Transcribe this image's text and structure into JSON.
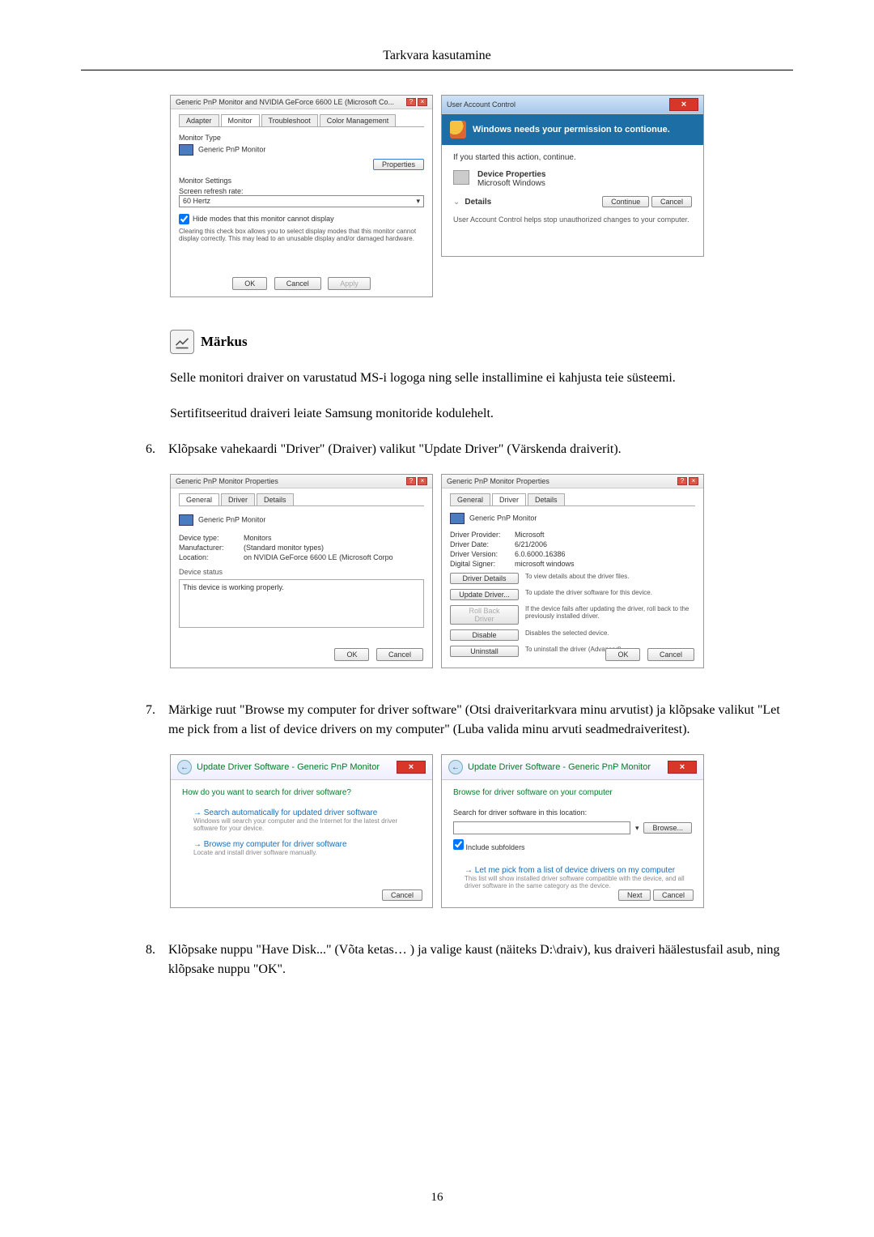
{
  "page_header": "Tarkvara kasutamine",
  "page_number": "16",
  "note": {
    "label": "Märkus"
  },
  "prose": {
    "p1": "Selle monitori draiver on varustatud MS-i logoga ning selle installimine ei kahjusta teie süsteemi.",
    "p2": "Sertifitseeritud draiveri leiate Samsung monitoride kodulehelt."
  },
  "steps": {
    "s6": {
      "num": "6.",
      "text": "Klõpsake vahekaardi \"Driver\" (Draiver) valikut \"Update Driver\" (Värskenda draiverit)."
    },
    "s7": {
      "num": "7.",
      "text": "Märkige ruut \"Browse my computer for driver software\" (Otsi draiveritarkvara minu arvutist) ja klõpsake valikut \"Let me pick from a list of device drivers on my computer\" (Luba valida minu arvuti seadmedraiveritest)."
    },
    "s8": {
      "num": "8.",
      "text": "Klõpsake nuppu \"Have Disk...\" (Võta ketas… ) ja valige kaust (näiteks D:\\draiv), kus draiveri häälestusfail asub, ning klõpsake nuppu \"OK\"."
    }
  },
  "monitorDlg": {
    "title": "Generic PnP Monitor and NVIDIA GeForce 6600 LE (Microsoft Co...",
    "tabs": {
      "adapter": "Adapter",
      "monitor": "Monitor",
      "troubleshoot": "Troubleshoot",
      "color": "Color Management"
    },
    "monitorTypeLabel": "Monitor Type",
    "monitorType": "Generic PnP Monitor",
    "propertiesBtn": "Properties",
    "settingsLabel": "Monitor Settings",
    "refreshLabel": "Screen refresh rate:",
    "refreshVal": "60 Hertz",
    "hideModes": "Hide modes that this monitor cannot display",
    "hideDesc": "Clearing this check box allows you to select display modes that this monitor cannot display correctly. This may lead to an unusable display and/or damaged hardware.",
    "ok": "OK",
    "cancel": "Cancel",
    "apply": "Apply"
  },
  "uac": {
    "bar": "User Account Control",
    "headline": "Windows needs your permission to contionue.",
    "started": "If you started this action, continue.",
    "itemTitle": "Device Properties",
    "itemSub": "Microsoft Windows",
    "details": "Details",
    "continue": "Continue",
    "cancel": "Cancel",
    "hint": "User Account Control helps stop unauthorized changes to your computer."
  },
  "propsGeneral": {
    "title": "Generic PnP Monitor Properties",
    "tabs": {
      "general": "General",
      "driver": "Driver",
      "details": "Details"
    },
    "name": "Generic PnP Monitor",
    "deviceTypeL": "Device type:",
    "deviceType": "Monitors",
    "manufacturerL": "Manufacturer:",
    "manufacturer": "(Standard monitor types)",
    "locationL": "Location:",
    "location": "on NVIDIA GeForce 6600 LE (Microsoft Corpo",
    "statusLabel": "Device status",
    "status": "This device is working properly.",
    "ok": "OK",
    "cancel": "Cancel"
  },
  "propsDriver": {
    "title": "Generic PnP Monitor Properties",
    "name": "Generic PnP Monitor",
    "providerL": "Driver Provider:",
    "provider": "Microsoft",
    "dateL": "Driver Date:",
    "date": "6/21/2006",
    "versionL": "Driver Version:",
    "version": "6.0.6000.16386",
    "signerL": "Digital Signer:",
    "signer": "microsoft windows",
    "btnDetails": "Driver Details",
    "descDetails": "To view details about the driver files.",
    "btnUpdate": "Update Driver...",
    "descUpdate": "To update the driver software for this device.",
    "btnRollback": "Roll Back Driver",
    "descRollback": "If the device fails after updating the driver, roll back to the previously installed driver.",
    "btnDisable": "Disable",
    "descDisable": "Disables the selected device.",
    "btnUninstall": "Uninstall",
    "descUninstall": "To uninstall the driver (Advanced).",
    "ok": "OK",
    "cancel": "Cancel"
  },
  "wizard1": {
    "crumb": "Update Driver Software - Generic PnP Monitor",
    "q": "How do you want to search for driver software?",
    "opt1t": "Search automatically for updated driver software",
    "opt1s": "Windows will search your computer and the Internet for the latest driver software for your device.",
    "opt2t": "Browse my computer for driver software",
    "opt2s": "Locate and install driver software manually.",
    "cancel": "Cancel"
  },
  "wizard2": {
    "crumb": "Update Driver Software - Generic PnP Monitor",
    "q": "Browse for driver software on your computer",
    "searchLbl": "Search for driver software in this location:",
    "browse": "Browse...",
    "includeSub": "Include subfolders",
    "opt1t": "Let me pick from a list of device drivers on my computer",
    "opt1s": "This list will show installed driver software compatible with the device, and all driver software in the same category as the device.",
    "next": "Next",
    "cancel": "Cancel"
  }
}
